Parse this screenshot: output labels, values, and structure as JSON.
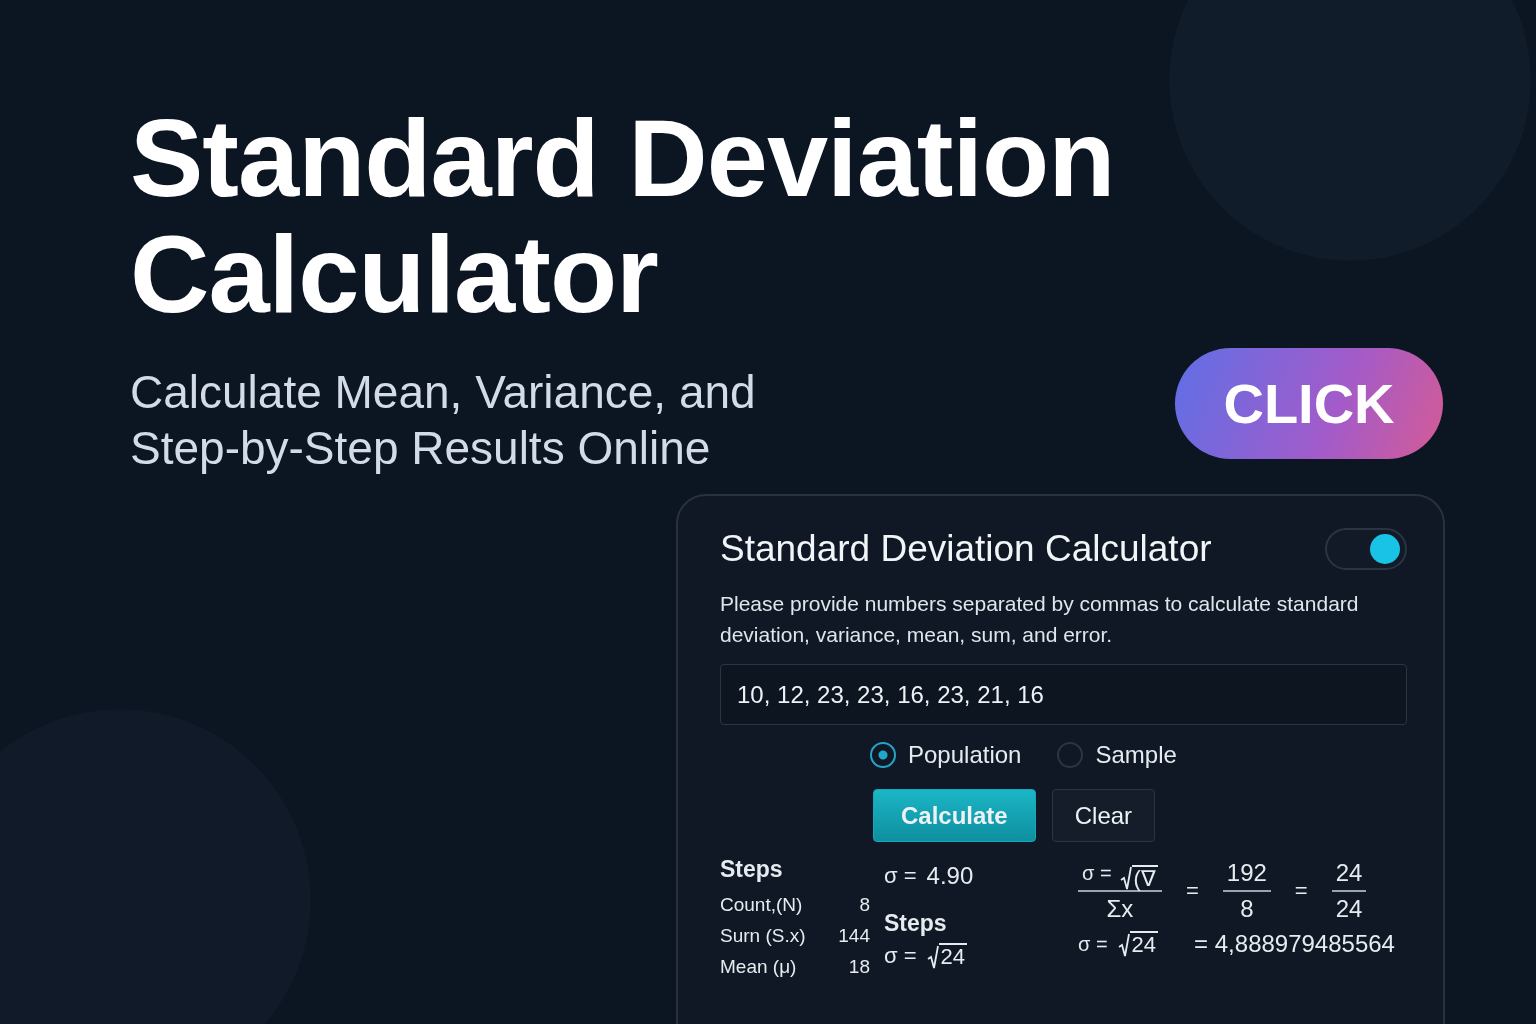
{
  "hero": {
    "title_lines": [
      "Standard Deviation",
      "Calculator"
    ],
    "subtitle_lines": [
      "Calculate Mean, Variance, and",
      "Step-by-Step Results Online"
    ],
    "cta": "CLICK"
  },
  "card": {
    "title": "Standard Deviation Calculator",
    "toggle": {
      "on": true
    },
    "description": "Please provide numbers separated by commas to calculate standard deviation, variance, mean, sum, and error.",
    "input": {
      "value": "10, 12, 23, 23, 16, 23, 21, 16"
    },
    "modes": [
      {
        "label": "Population",
        "selected": true
      },
      {
        "label": "Sample",
        "selected": false
      }
    ],
    "buttons": [
      {
        "label": "Calculate",
        "kind": "primary"
      },
      {
        "label": "Clear",
        "kind": "secondary"
      }
    ],
    "summary": {
      "heading": "Steps",
      "rows": [
        {
          "label": "Count,(N)",
          "value": "8"
        },
        {
          "label": "Surn (S.x)",
          "value": "144"
        },
        {
          "label": "Mean (μ)",
          "value": "18"
        }
      ]
    },
    "result": {
      "symbol": "σ =",
      "value": "4.90",
      "heading": "Steps",
      "root_symbol": "σ =",
      "root": "24"
    },
    "formula": {
      "symbol": "σ =",
      "numerator_root": "(∇",
      "denominator": "Σx",
      "eq1": "=",
      "frac1": [
        "192",
        "8"
      ],
      "eq2": "=",
      "frac2": [
        "24",
        "24"
      ],
      "line2_symbol": "σ =",
      "line2_root": "24",
      "line2_result": "= 4,888979485564"
    }
  }
}
